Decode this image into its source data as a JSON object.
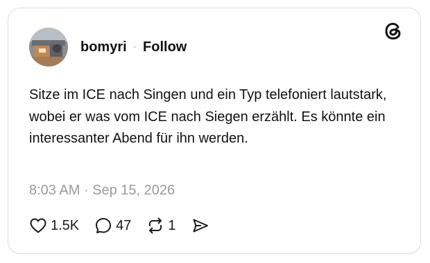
{
  "post": {
    "username": "bomyri",
    "separator": "·",
    "follow_label": "Follow",
    "text": "Sitze im ICE nach Singen und ein Typ telefoniert lautstark, wobei er was vom ICE nach Siegen erzählt. Es könnte ein interessanter Abend für ihn werden.",
    "timestamp": "8:03 AM · Sep 15, 2026",
    "likes": "1.5K",
    "replies": "47",
    "reposts": "1"
  },
  "icons": {
    "brand": "threads-logo-icon",
    "like": "heart-icon",
    "reply": "speech-bubble-icon",
    "repost": "repost-icon",
    "share": "send-icon"
  },
  "colors": {
    "text": "#111111",
    "muted": "#9b9b9b",
    "border": "#dcdcdc"
  }
}
